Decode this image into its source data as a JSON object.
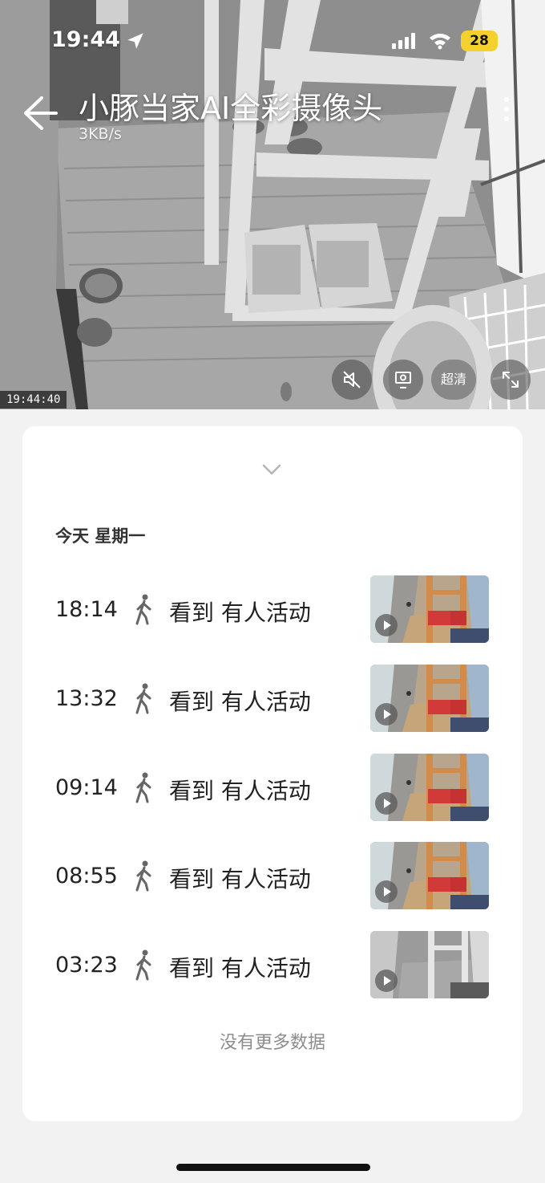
{
  "status_bar": {
    "time": "19:44",
    "battery": "28",
    "icons": [
      "location-arrow-icon",
      "cellular-signal-icon",
      "wifi-icon",
      "battery-icon"
    ]
  },
  "camera": {
    "title": "小豚当家AI全彩摄像头",
    "speed": "3KB/s",
    "timestamp": "19:44:40",
    "quality": "超清",
    "icons": [
      "back-arrow-icon",
      "more-icon",
      "mute-icon",
      "screenshot-icon",
      "fullscreen-icon"
    ]
  },
  "events": {
    "date_label": "今天 星期一",
    "items": [
      {
        "time": "18:14",
        "text": "看到 有人活动",
        "thumb": "color"
      },
      {
        "time": "13:32",
        "text": "看到 有人活动",
        "thumb": "color"
      },
      {
        "time": "09:14",
        "text": "看到 有人活动",
        "thumb": "color"
      },
      {
        "time": "08:55",
        "text": "看到 有人活动",
        "thumb": "color"
      },
      {
        "time": "03:23",
        "text": "看到 有人活动",
        "thumb": "gray"
      }
    ],
    "footer": "没有更多数据",
    "icons": [
      "collapse-chevron-icon",
      "walking-person-icon",
      "play-icon"
    ]
  },
  "colors": {
    "battery_badge": "#f4d12c",
    "card_background": "#ffffff",
    "page_background": "#f2f2f2",
    "footer_text": "#8d8d8d"
  }
}
